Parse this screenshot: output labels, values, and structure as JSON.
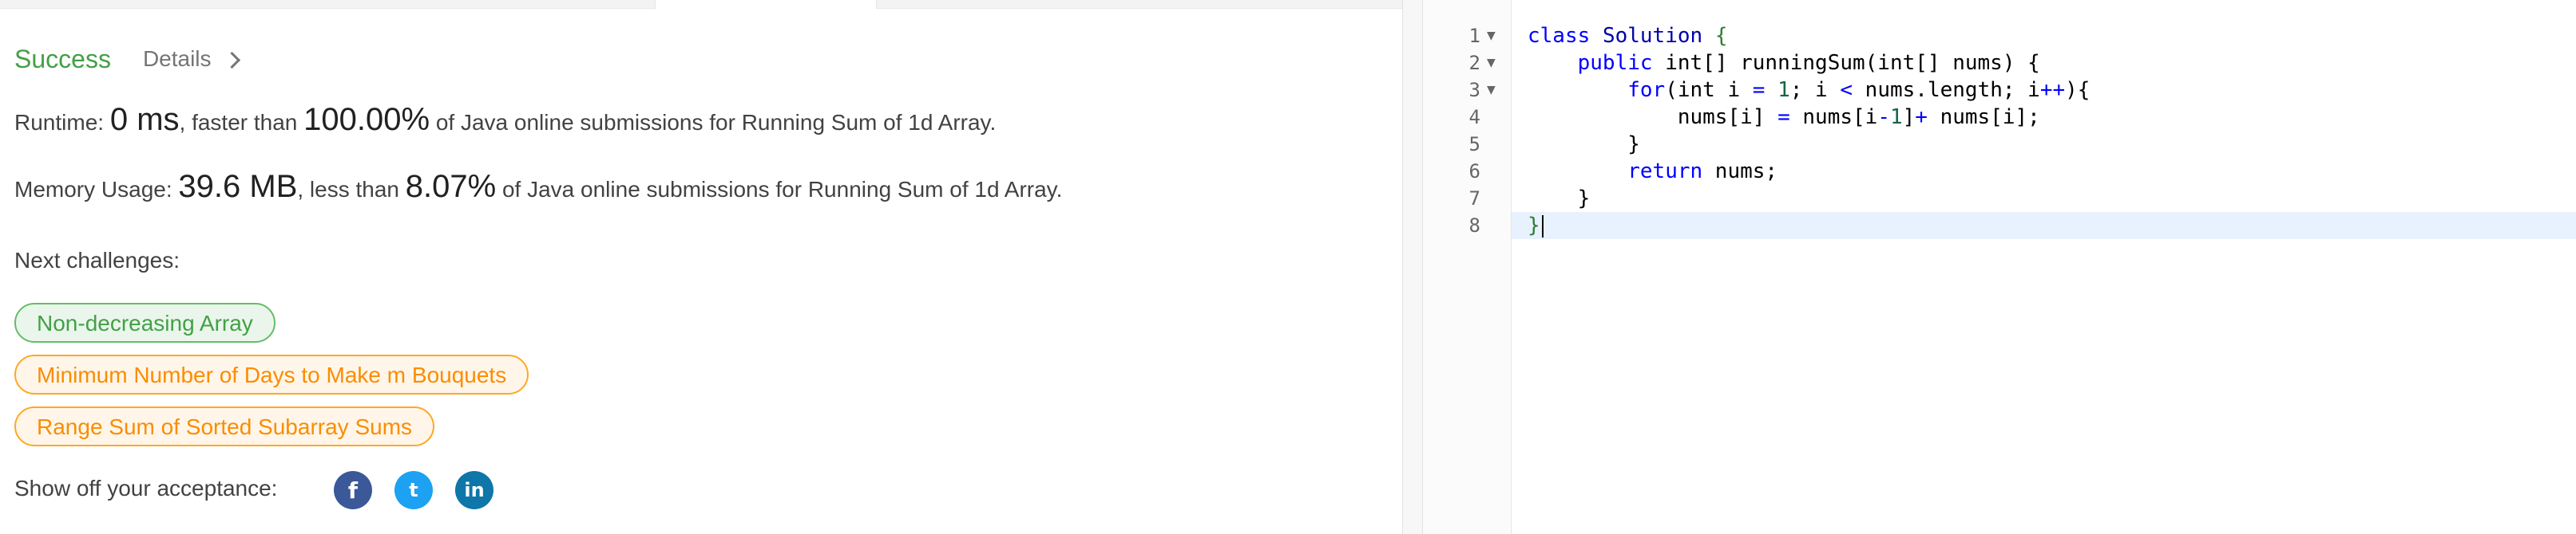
{
  "result": {
    "status": "Success",
    "details_label": "Details",
    "runtime": {
      "label": "Runtime: ",
      "value": "0 ms",
      "mid": ", faster than ",
      "percent": "100.00%",
      "tail": " of Java online submissions for Running Sum of 1d Array."
    },
    "memory": {
      "label": "Memory Usage: ",
      "value": "39.6 MB",
      "mid": ", less than ",
      "percent": "8.07%",
      "tail": " of Java online submissions for Running Sum of 1d Array."
    }
  },
  "next_challenges": {
    "title": "Next challenges:",
    "items": [
      {
        "label": "Non-decreasing Array",
        "difficulty": "easy"
      },
      {
        "label": "Minimum Number of Days to Make m Bouquets",
        "difficulty": "medium"
      },
      {
        "label": "Range Sum of Sorted Subarray Sums",
        "difficulty": "medium"
      }
    ]
  },
  "share": {
    "label": "Show off your acceptance:",
    "icons": [
      "facebook-icon",
      "twitter-icon",
      "linkedin-icon"
    ],
    "glyphs": {
      "facebook": "f",
      "twitter": "t",
      "linkedin": "in"
    }
  },
  "editor": {
    "line_numbers": [
      "1",
      "2",
      "3",
      "4",
      "5",
      "6",
      "7",
      "8"
    ],
    "current_line": 8
  },
  "colors": {
    "success": "#43a047",
    "easy": "#43a047",
    "medium": "#fb8c00",
    "facebook": "#3b5998",
    "twitter": "#1da1f2",
    "linkedin": "#0e76a8"
  }
}
